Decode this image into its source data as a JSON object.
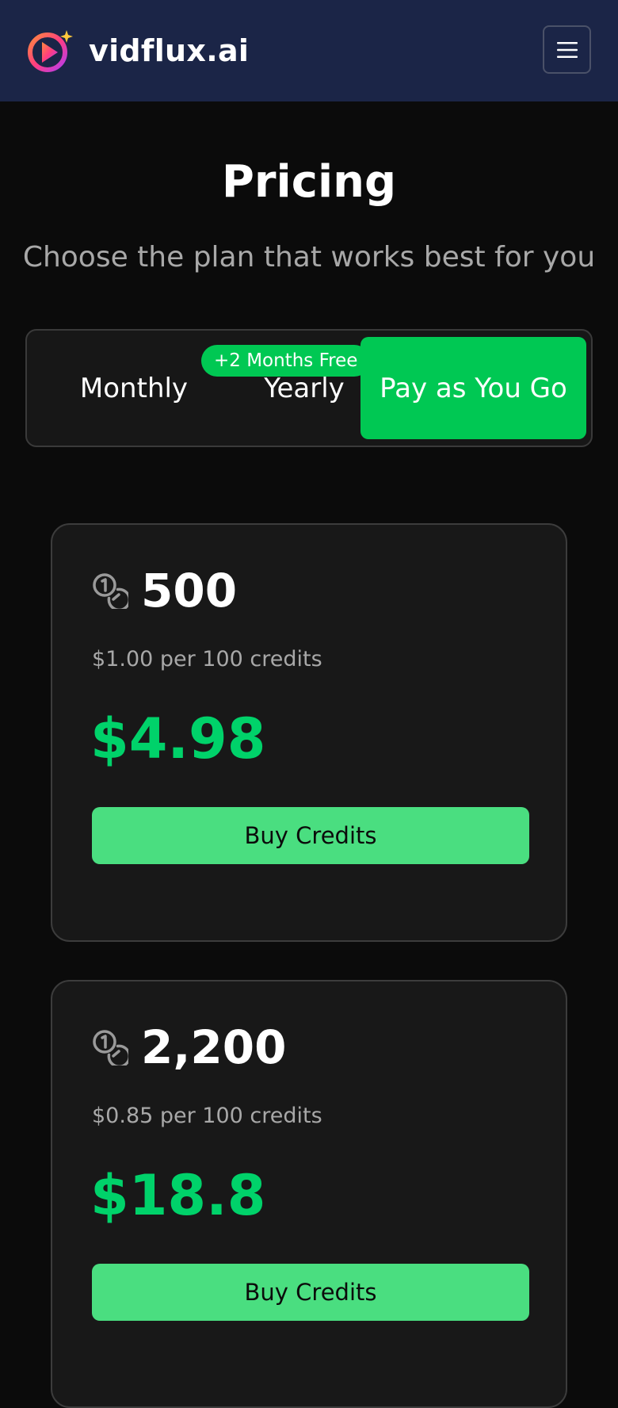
{
  "header": {
    "brand_name": "vidflux.ai",
    "menu_icon": "hamburger-menu-icon",
    "background_color": "#1b2547"
  },
  "page": {
    "title": "Pricing",
    "subtitle": "Choose the plan that works best for you"
  },
  "billing_toggle": {
    "options": [
      {
        "label": "Monthly",
        "selected": false
      },
      {
        "label": "Yearly",
        "selected": false,
        "badge": "+2 Months Free"
      },
      {
        "label": "Pay as You Go",
        "selected": true
      }
    ],
    "accent_color": "#00c853"
  },
  "plans": [
    {
      "credits": "500",
      "rate": "$1.00 per 100 credits",
      "price": "$4.98",
      "button_label": "Buy Credits",
      "icon": "coins-icon"
    },
    {
      "credits": "2,200",
      "rate": "$0.85 per 100 credits",
      "price": "$18.8",
      "button_label": "Buy Credits",
      "icon": "coins-icon"
    }
  ],
  "colors": {
    "price_green": "#00d26a",
    "button_green": "#4ade80",
    "card_background": "#181818",
    "page_background": "#0b0b0b"
  }
}
